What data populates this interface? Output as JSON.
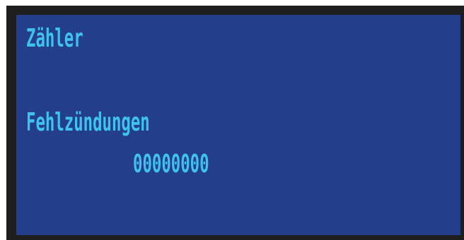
{
  "display": {
    "title": "Zähler",
    "counter_label": "Fehlzündungen",
    "counter_value": "00000000"
  },
  "colors": {
    "bezel": "#1e1e1e",
    "screen_background": "#233f8c",
    "text": "#3fc3ee"
  }
}
